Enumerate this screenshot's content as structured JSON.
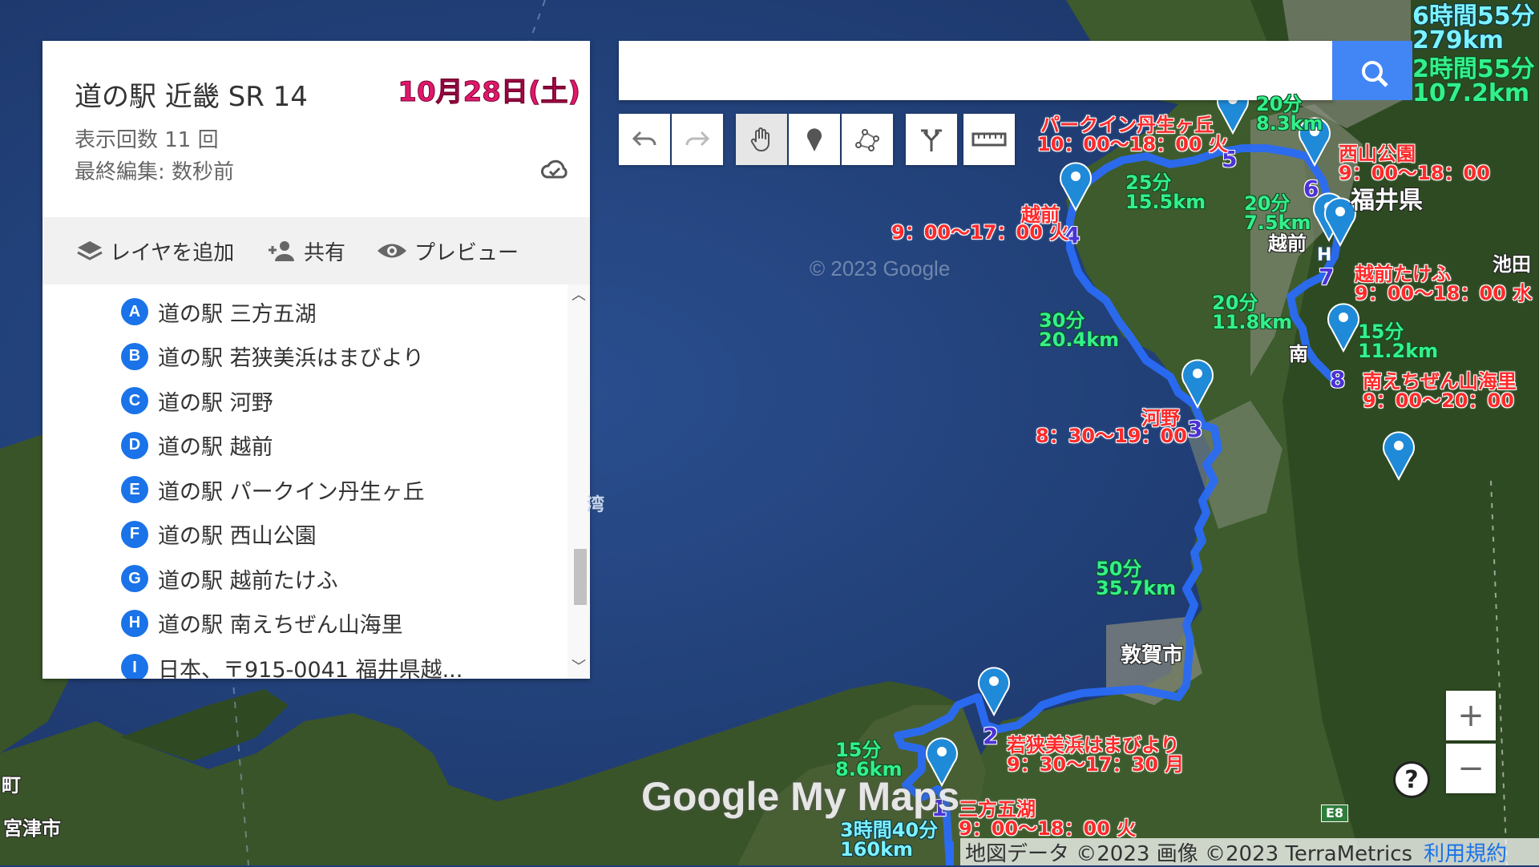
{
  "panel": {
    "title": "道の駅 近畿 SR 14",
    "date_label": "10月28日(土)",
    "views": "表示回数 11 回",
    "last_edited": "最終編集: 数秒前",
    "add_layer": "レイヤを追加",
    "share": "共有",
    "preview": "プレビュー",
    "items": [
      {
        "badge": "A",
        "label": "道の駅 三方五湖"
      },
      {
        "badge": "B",
        "label": "道の駅 若狭美浜はまびより"
      },
      {
        "badge": "C",
        "label": "道の駅 河野"
      },
      {
        "badge": "D",
        "label": "道の駅 越前"
      },
      {
        "badge": "E",
        "label": "道の駅 パークイン丹生ヶ丘"
      },
      {
        "badge": "F",
        "label": "道の駅 西山公園"
      },
      {
        "badge": "G",
        "label": "道の駅 越前たけふ"
      },
      {
        "badge": "H",
        "label": "道の駅 南えちぜん山海里"
      },
      {
        "badge": "I",
        "label": "日本、〒915-0041 福井県越..."
      }
    ]
  },
  "search": {
    "value": ""
  },
  "summary": {
    "total_time": "6時間55分",
    "total_dist": "279km",
    "part_time": "2時間55分",
    "part_dist": "107.2km"
  },
  "stops": [
    {
      "num": "1",
      "name": "三方五湖",
      "hours": "9：00〜18：00 火"
    },
    {
      "num": "2",
      "name": "若狭美浜はまびより",
      "hours": "9：30〜17：30 月"
    },
    {
      "num": "3",
      "name": "河野",
      "hours": "8：30〜19：00"
    },
    {
      "num": "4",
      "name": "越前",
      "hours": "9：00〜17：00 火"
    },
    {
      "num": "5",
      "name": "パークイン丹生ヶ丘",
      "hours": "10：00〜18：00 火"
    },
    {
      "num": "6",
      "name": "西山公園",
      "hours": "9：00〜18：00"
    },
    {
      "num": "7",
      "name": "越前たけふ",
      "hours": "9：00〜18：00 水"
    },
    {
      "num": "8",
      "name": "南えちぜん山海里",
      "hours": "9：00〜20：00"
    }
  ],
  "legs": [
    {
      "time": "3時間40分",
      "dist": "160km"
    },
    {
      "time": "15分",
      "dist": "8.6km"
    },
    {
      "time": "50分",
      "dist": "35.7km"
    },
    {
      "time": "30分",
      "dist": "20.4km"
    },
    {
      "time": "25分",
      "dist": "15.5km"
    },
    {
      "time": "20分",
      "dist": "8.3km"
    },
    {
      "time": "20分",
      "dist": "7.5km"
    },
    {
      "time": "20分",
      "dist": "11.8km"
    },
    {
      "time": "15分",
      "dist": "11.2km"
    }
  ],
  "place_names": {
    "fukui": "福井県",
    "tsuruga": "敦賀市",
    "echizen": "越前",
    "nanjo": "南",
    "miyazu": "宮津市",
    "machi": "町",
    "ikeda": "池田",
    "bay": "湾",
    "e8": "E8",
    "h_marker": "H"
  },
  "map": {
    "watermark": "Google My Maps",
    "copyright": "© 2023 Google",
    "attribution": "地図データ ©2023 画像 ©2023 TerraMetrics",
    "terms": "利用規約",
    "route_color": "#2a6cf5",
    "marker_color": "#1f8ad8"
  }
}
